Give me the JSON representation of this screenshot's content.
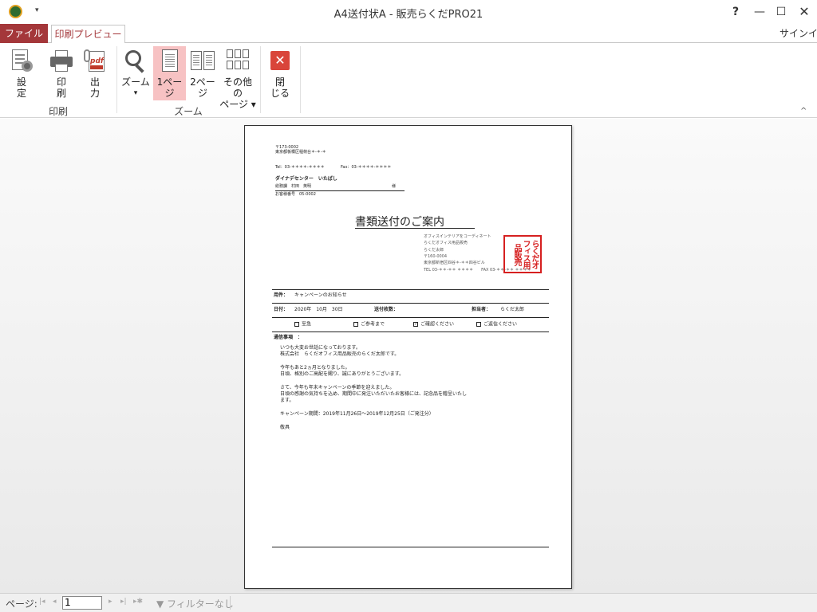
{
  "window": {
    "title": "A4送付状A - 販売らくだPRO21",
    "help": "?",
    "minimize": "—",
    "maximize": "☐",
    "close": "✕",
    "qat_dropdown": "▾"
  },
  "tabs": {
    "file": "ファイル",
    "print_preview": "印刷プレビュー",
    "signin": "サインイン"
  },
  "ribbon": {
    "print_group": {
      "label": "印刷",
      "settings": [
        "設",
        "定"
      ],
      "print": [
        "印",
        "刷"
      ],
      "output": [
        "出",
        "力"
      ]
    },
    "zoom_group": {
      "label": "ズーム",
      "zoom": "ズーム",
      "zoom_arrow": "▾",
      "one_page": [
        "1ペー",
        "ジ"
      ],
      "two_page": [
        "2ペー",
        "ジ"
      ],
      "other_pages": [
        "その他の",
        "ページ ▾"
      ]
    },
    "close_group": {
      "close": [
        "閉",
        "じる"
      ]
    },
    "collapse": "^"
  },
  "document": {
    "sender_zip": "〒173-0002",
    "sender_addr": "東京都板橋区稲荷台＊-＊-＊",
    "tel": "Tel：03-＊＊＊＊-＊＊＊＊",
    "fax": "Fax：03-＊＊＊＊-＊＊＊＊",
    "recipient_company": "ダイナデセンター　いたばし",
    "recipient_person": "総務課　村田　英明",
    "honorific": "様",
    "customer_no": "お客様番号　05-0002",
    "title": "書類送付のご案内",
    "company_lines": [
      "オフィスインテリアをコーディネート",
      "らくだオフィス用品販売",
      "らくだ太郎",
      "〒160-0004",
      "東京都新宿区四谷＊-＊＊四谷ビル",
      "TEL 03-＊＊-＊＊ ＊＊＊＊　　FAX 03-＊＊-＊＊ ＊＊＊＊"
    ],
    "stamp_text": "らくだオフィス用品販売",
    "subject_label": "用件：",
    "subject_value": "キャンペーンのお知らせ",
    "date_label": "日付：",
    "date_value": "2020年　10月　30日",
    "pages_label": "送付枚数：",
    "person_label": "担当者：",
    "person_value": "らくだ太郎",
    "checkboxes": [
      {
        "mark": "",
        "label": "至急"
      },
      {
        "mark": "",
        "label": "ご参考まで"
      },
      {
        "mark": "✓",
        "label": "ご確認ください"
      },
      {
        "mark": "",
        "label": "ご返信ください"
      }
    ],
    "notes_label": "通信事項　：",
    "body_lines": [
      "いつも大変お世話になっております。",
      "株式会社　らくだオフィス用品販売のらくだ太郎です。",
      "今年もあと2ヵ月となりました。",
      "日頃、格別のご高配を賜り、誠にありがとうございます。",
      "さて、今年も年末キャンペーンの季節を迎えました。",
      "日頃の感謝の気持ちを込め、期間中に発注いただいたお客様には、記念品を贈呈いたし",
      "ます。",
      "キャンペーン期間：2019年11月26日～2019年12月25日（ご発注分）",
      "敬具"
    ]
  },
  "statusbar": {
    "page_label": "ページ:",
    "first": "|◂",
    "prev": "◂",
    "page_value": "1",
    "next": "▸",
    "last": "▸|",
    "new": "▸✱",
    "filter": "▼ フィルターなし"
  },
  "colors": {
    "accent": "#a4373a",
    "active_button": "#f7c2c3",
    "stamp": "#d62020"
  }
}
